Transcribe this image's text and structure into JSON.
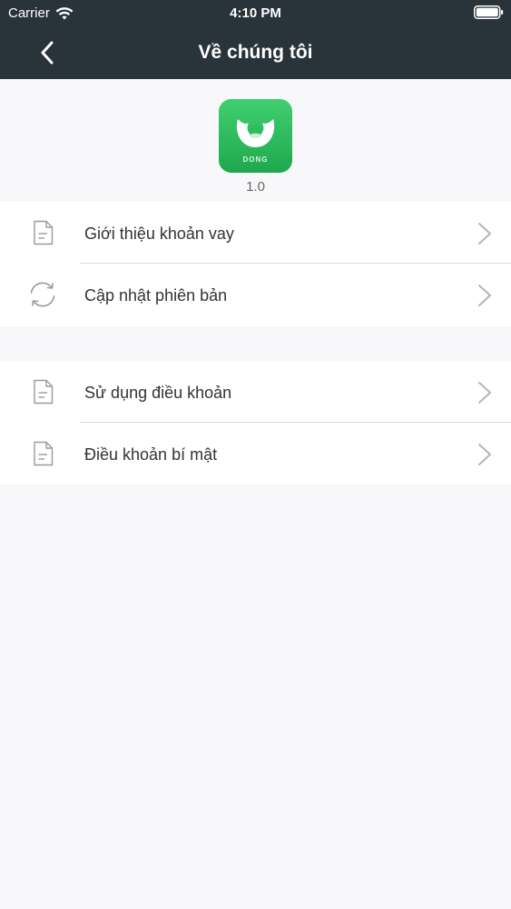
{
  "status_bar": {
    "carrier": "Carrier",
    "time": "4:10 PM",
    "wifi_icon": "wifi-icon",
    "battery_icon": "battery-icon"
  },
  "nav": {
    "title": "Về chúng tôi",
    "back_icon": "chevron-left-icon"
  },
  "app": {
    "logo_text": "DONG",
    "version": "1.0",
    "logo_color": "#26b45a"
  },
  "groups": [
    {
      "items": [
        {
          "label": "Giới thiệu khoản vay",
          "icon": "document-icon"
        },
        {
          "label": "Cập nhật phiên bản",
          "icon": "refresh-icon"
        }
      ]
    },
    {
      "items": [
        {
          "label": "Sử dụng điều khoản",
          "icon": "document-icon"
        },
        {
          "label": "Điều khoản bí mật",
          "icon": "document-icon"
        }
      ]
    }
  ],
  "colors": {
    "header_bg": "#29343a",
    "page_bg": "#f8f8fa",
    "row_bg": "#ffffff",
    "accent_green": "#26b45a"
  }
}
